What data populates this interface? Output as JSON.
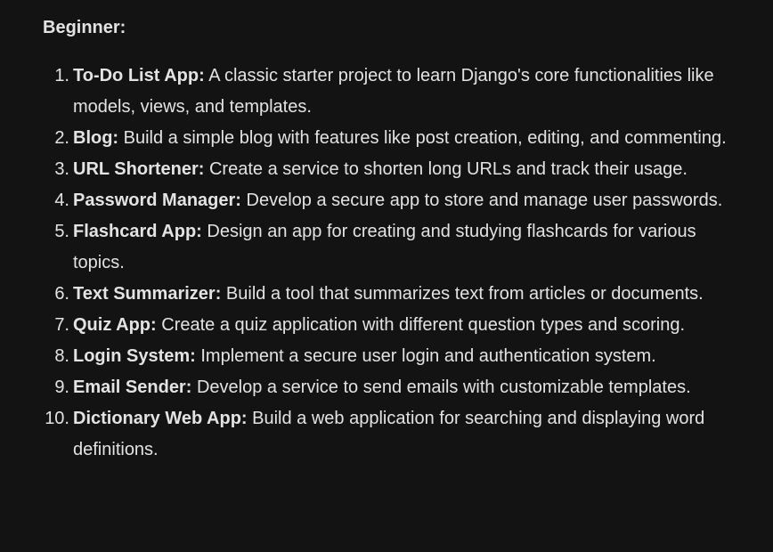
{
  "heading": "Beginner:",
  "items": [
    {
      "num": "1.",
      "title": "To-Do List App:",
      "text": " A classic starter project to learn Django's core functionalities like models, views, and templates."
    },
    {
      "num": "2.",
      "title": "Blog:",
      "text": " Build a simple blog with features like post creation, editing, and commenting."
    },
    {
      "num": "3.",
      "title": "URL Shortener:",
      "text": " Create a service to shorten long URLs and track their usage."
    },
    {
      "num": "4.",
      "title": "Password Manager:",
      "text": " Develop a secure app to store and manage user passwords."
    },
    {
      "num": "5.",
      "title": "Flashcard App:",
      "text": " Design an app for creating and studying flashcards for various topics."
    },
    {
      "num": "6.",
      "title": "Text Summarizer:",
      "text": " Build a tool that summarizes text from articles or documents."
    },
    {
      "num": "7.",
      "title": "Quiz App:",
      "text": " Create a quiz application with different question types and scoring."
    },
    {
      "num": "8.",
      "title": "Login System:",
      "text": " Implement a secure user login and authentication system."
    },
    {
      "num": "9.",
      "title": "Email Sender:",
      "text": " Develop a service to send emails with customizable templates."
    },
    {
      "num": "10.",
      "title": "Dictionary Web App:",
      "text": " Build a web application for searching and displaying word definitions."
    }
  ]
}
